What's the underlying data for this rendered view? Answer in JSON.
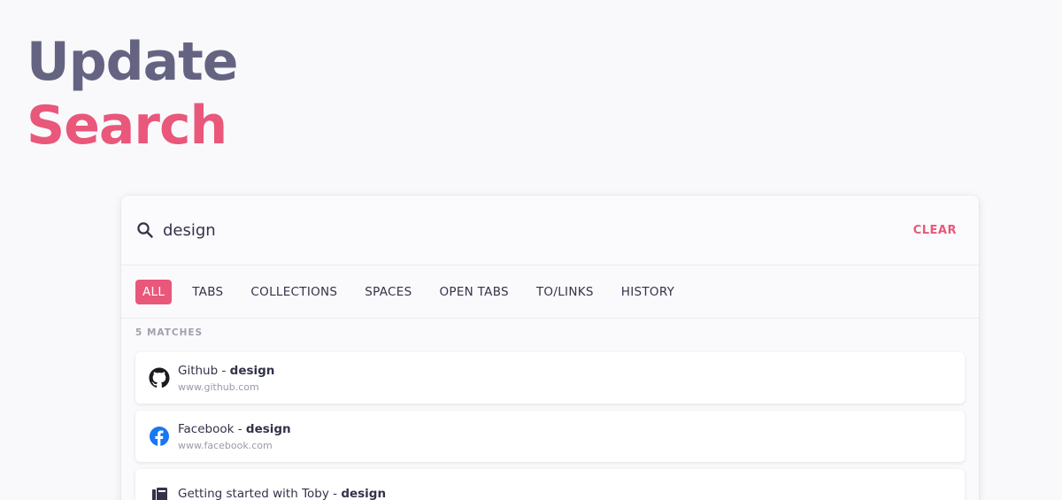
{
  "hero": {
    "line1": "Update",
    "line2": "Search"
  },
  "search": {
    "value": "design",
    "clear_label": "CLEAR"
  },
  "tabs": [
    {
      "label": "ALL",
      "active": true
    },
    {
      "label": "TABS"
    },
    {
      "label": "COLLECTIONS"
    },
    {
      "label": "SPACES"
    },
    {
      "label": "OPEN TABS"
    },
    {
      "label": "TO/LINKS"
    },
    {
      "label": "HISTORY"
    }
  ],
  "matches_label": "5 MATCHES",
  "results": [
    {
      "icon": "github-icon",
      "name": "Github",
      "separator": " - ",
      "query": "design",
      "url": "www.github.com"
    },
    {
      "icon": "facebook-icon",
      "name": "Facebook",
      "separator": " - ",
      "query": "design",
      "url": "www.facebook.com"
    },
    {
      "icon": "toby-icon",
      "name": "Getting started with Toby",
      "separator": " - ",
      "query": "design",
      "url": ""
    }
  ],
  "colors": {
    "accent": "#e9577b",
    "hero_dark": "#646482",
    "facebook": "#1877f2"
  }
}
